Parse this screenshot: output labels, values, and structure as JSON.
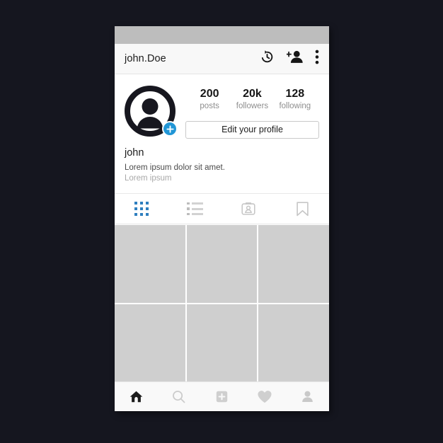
{
  "theme": {
    "page_background": "#15161f",
    "status_bar": "#bdbdbd",
    "header_background": "#f8f8f8",
    "accent_blue": "#2196d6",
    "tab_active_blue": "#2f7fbf",
    "tile_gray": "#cfcfcf",
    "muted_text": "#8e8e8e"
  },
  "header": {
    "username": "john.Doe",
    "icons": [
      {
        "name": "history-icon",
        "label": "History"
      },
      {
        "name": "add-person-icon",
        "label": "Discover people"
      },
      {
        "name": "overflow-menu-icon",
        "label": "Options"
      }
    ]
  },
  "profile": {
    "avatar": {
      "name": "profile-avatar",
      "badge": "add-story-badge"
    },
    "stats": [
      {
        "value": "200",
        "label": "posts"
      },
      {
        "value": "20k",
        "label": "followers"
      },
      {
        "value": "128",
        "label": "following"
      }
    ],
    "edit_button": "Edit your profile",
    "bio": {
      "name": "john",
      "line1": "Lorem ipsum dolor sit amet.",
      "line2": "Lorem ipsum"
    }
  },
  "tabs": [
    {
      "name": "tab-grid",
      "icon": "grid-icon",
      "active": true
    },
    {
      "name": "tab-list",
      "icon": "list-icon",
      "active": false
    },
    {
      "name": "tab-tagged",
      "icon": "tagged-photo-icon",
      "active": false
    },
    {
      "name": "tab-saved",
      "icon": "bookmark-icon",
      "active": false
    }
  ],
  "photo_grid": {
    "tiles": [
      {
        "name": "photo-tile-1"
      },
      {
        "name": "photo-tile-2"
      },
      {
        "name": "photo-tile-3"
      },
      {
        "name": "photo-tile-4"
      },
      {
        "name": "photo-tile-5"
      },
      {
        "name": "photo-tile-6"
      }
    ]
  },
  "bottom_nav": [
    {
      "name": "nav-home",
      "icon": "home-icon",
      "active": true
    },
    {
      "name": "nav-search",
      "icon": "search-icon",
      "active": false
    },
    {
      "name": "nav-add",
      "icon": "add-square-icon",
      "active": false
    },
    {
      "name": "nav-activity",
      "icon": "heart-icon",
      "active": false
    },
    {
      "name": "nav-profile",
      "icon": "person-icon",
      "active": false
    }
  ]
}
